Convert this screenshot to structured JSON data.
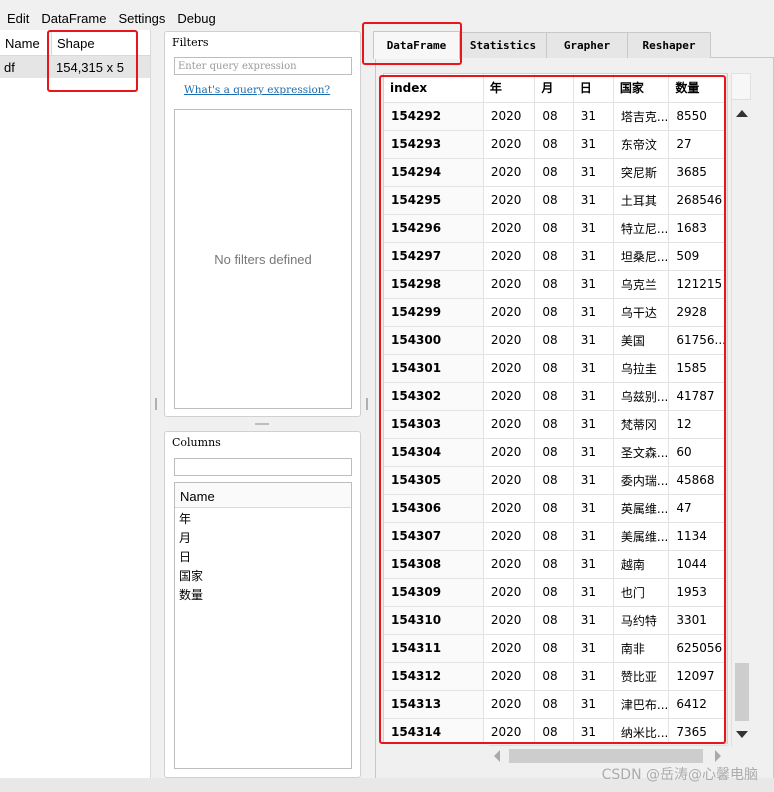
{
  "menubar": {
    "items": [
      "Edit",
      "DataFrame",
      "Settings",
      "Debug"
    ]
  },
  "df_list": {
    "headers": {
      "name": "Name",
      "shape": "Shape"
    },
    "rows": [
      {
        "name": "df",
        "shape": "154,315 x 5"
      }
    ]
  },
  "filters": {
    "title": "Filters",
    "query_placeholder": "Enter query expression",
    "help_link": "What's a query expression?",
    "empty_text": "No filters defined"
  },
  "columns_panel": {
    "title": "Columns",
    "search_value": "",
    "header": "Name",
    "items": [
      "年",
      "月",
      "日",
      "国家",
      "数量"
    ]
  },
  "tabs": [
    "DataFrame",
    "Statistics",
    "Grapher",
    "Reshaper"
  ],
  "active_tab": "DataFrame",
  "grid": {
    "headers": [
      "index",
      "年",
      "月",
      "日",
      "国家",
      "数量"
    ],
    "rows": [
      [
        "154292",
        "2020",
        "08",
        "31",
        "塔吉克...",
        "8550"
      ],
      [
        "154293",
        "2020",
        "08",
        "31",
        "东帝汶",
        "27"
      ],
      [
        "154294",
        "2020",
        "08",
        "31",
        "突尼斯",
        "3685"
      ],
      [
        "154295",
        "2020",
        "08",
        "31",
        "土耳其",
        "268546"
      ],
      [
        "154296",
        "2020",
        "08",
        "31",
        "特立尼...",
        "1683"
      ],
      [
        "154297",
        "2020",
        "08",
        "31",
        "坦桑尼...",
        "509"
      ],
      [
        "154298",
        "2020",
        "08",
        "31",
        "乌克兰",
        "121215"
      ],
      [
        "154299",
        "2020",
        "08",
        "31",
        "乌干达",
        "2928"
      ],
      [
        "154300",
        "2020",
        "08",
        "31",
        "美国",
        "61756..."
      ],
      [
        "154301",
        "2020",
        "08",
        "31",
        "乌拉圭",
        "1585"
      ],
      [
        "154302",
        "2020",
        "08",
        "31",
        "乌兹别...",
        "41787"
      ],
      [
        "154303",
        "2020",
        "08",
        "31",
        "梵蒂冈",
        "12"
      ],
      [
        "154304",
        "2020",
        "08",
        "31",
        "圣文森...",
        "60"
      ],
      [
        "154305",
        "2020",
        "08",
        "31",
        "委内瑞...",
        "45868"
      ],
      [
        "154306",
        "2020",
        "08",
        "31",
        "英属维...",
        "47"
      ],
      [
        "154307",
        "2020",
        "08",
        "31",
        "美属维...",
        "1134"
      ],
      [
        "154308",
        "2020",
        "08",
        "31",
        "越南",
        "1044"
      ],
      [
        "154309",
        "2020",
        "08",
        "31",
        "也门",
        "1953"
      ],
      [
        "154310",
        "2020",
        "08",
        "31",
        "马约特",
        "3301"
      ],
      [
        "154311",
        "2020",
        "08",
        "31",
        "南非",
        "625056"
      ],
      [
        "154312",
        "2020",
        "08",
        "31",
        "赞比亚",
        "12097"
      ],
      [
        "154313",
        "2020",
        "08",
        "31",
        "津巴布...",
        "6412"
      ],
      [
        "154314",
        "2020",
        "08",
        "31",
        "纳米比...",
        "7365"
      ]
    ]
  },
  "watermark": "CSDN @岳涛@心馨电脑",
  "colors": {
    "annotation": "#e8161b",
    "link": "#1a6cb0"
  }
}
